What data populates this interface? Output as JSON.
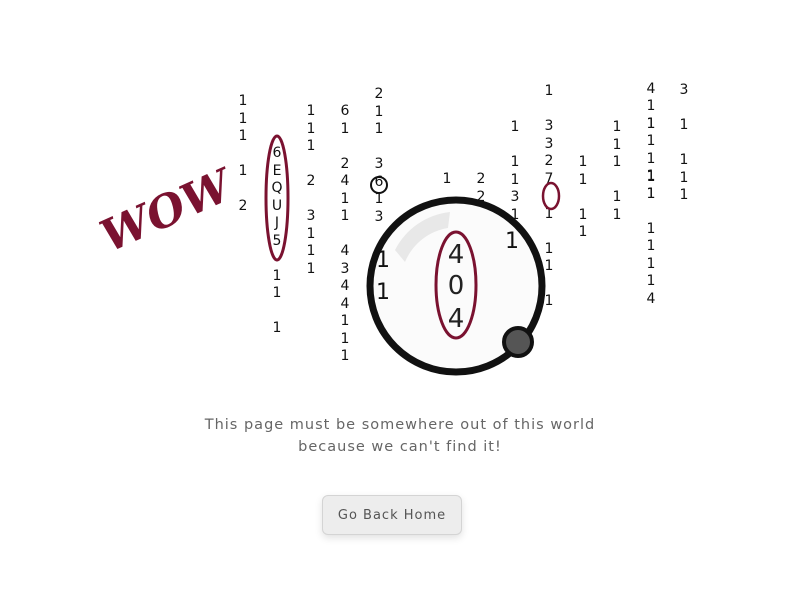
{
  "exclamation": "WOW!",
  "matrix_columns": [
    [
      "1",
      "1",
      "1",
      "",
      "1",
      "",
      "2"
    ],
    [
      "6",
      "E",
      "Q",
      "U",
      "J",
      "5",
      "",
      "1",
      "1",
      "",
      "1"
    ],
    [
      "1",
      "1",
      "1",
      "",
      "2",
      "",
      "3",
      "1",
      "1",
      "1"
    ],
    [
      "6",
      "1",
      "",
      "2",
      "4",
      "1",
      "1",
      "",
      "4",
      "3",
      "4",
      "4",
      "1",
      "1",
      "1"
    ],
    [
      "2",
      "1",
      "1",
      "",
      "3",
      "6",
      "1",
      "3"
    ],
    [
      "1"
    ],
    [
      "2",
      "2"
    ],
    [
      "1",
      "",
      "1",
      "1",
      "3",
      "1"
    ],
    [
      "1",
      "",
      "3",
      "3",
      "2",
      "7",
      "",
      "1",
      "",
      "1",
      "1",
      "",
      "1"
    ],
    [
      "1",
      "1",
      "",
      "1",
      "1"
    ],
    [
      "1",
      "1",
      "1",
      "",
      "1",
      "1"
    ],
    [
      "4",
      "",
      "1",
      "",
      "1",
      "1",
      "1"
    ],
    [
      "1",
      "1",
      "1",
      "",
      "1",
      "1",
      "",
      "1",
      "1",
      "1",
      "1",
      "4"
    ],
    [
      "3",
      "",
      "1",
      "",
      "1",
      "1",
      "1"
    ]
  ],
  "lens_digits": [
    "4",
    "0",
    "4"
  ],
  "side_digits": [
    "1",
    "1",
    "1"
  ],
  "message_line1": "This page must be somewhere out of this world",
  "message_line2": "because we can't find it!",
  "button_label": "Go Back Home",
  "colors": {
    "marker": "#7a1230",
    "text": "#666666",
    "button_bg": "#ededed"
  }
}
